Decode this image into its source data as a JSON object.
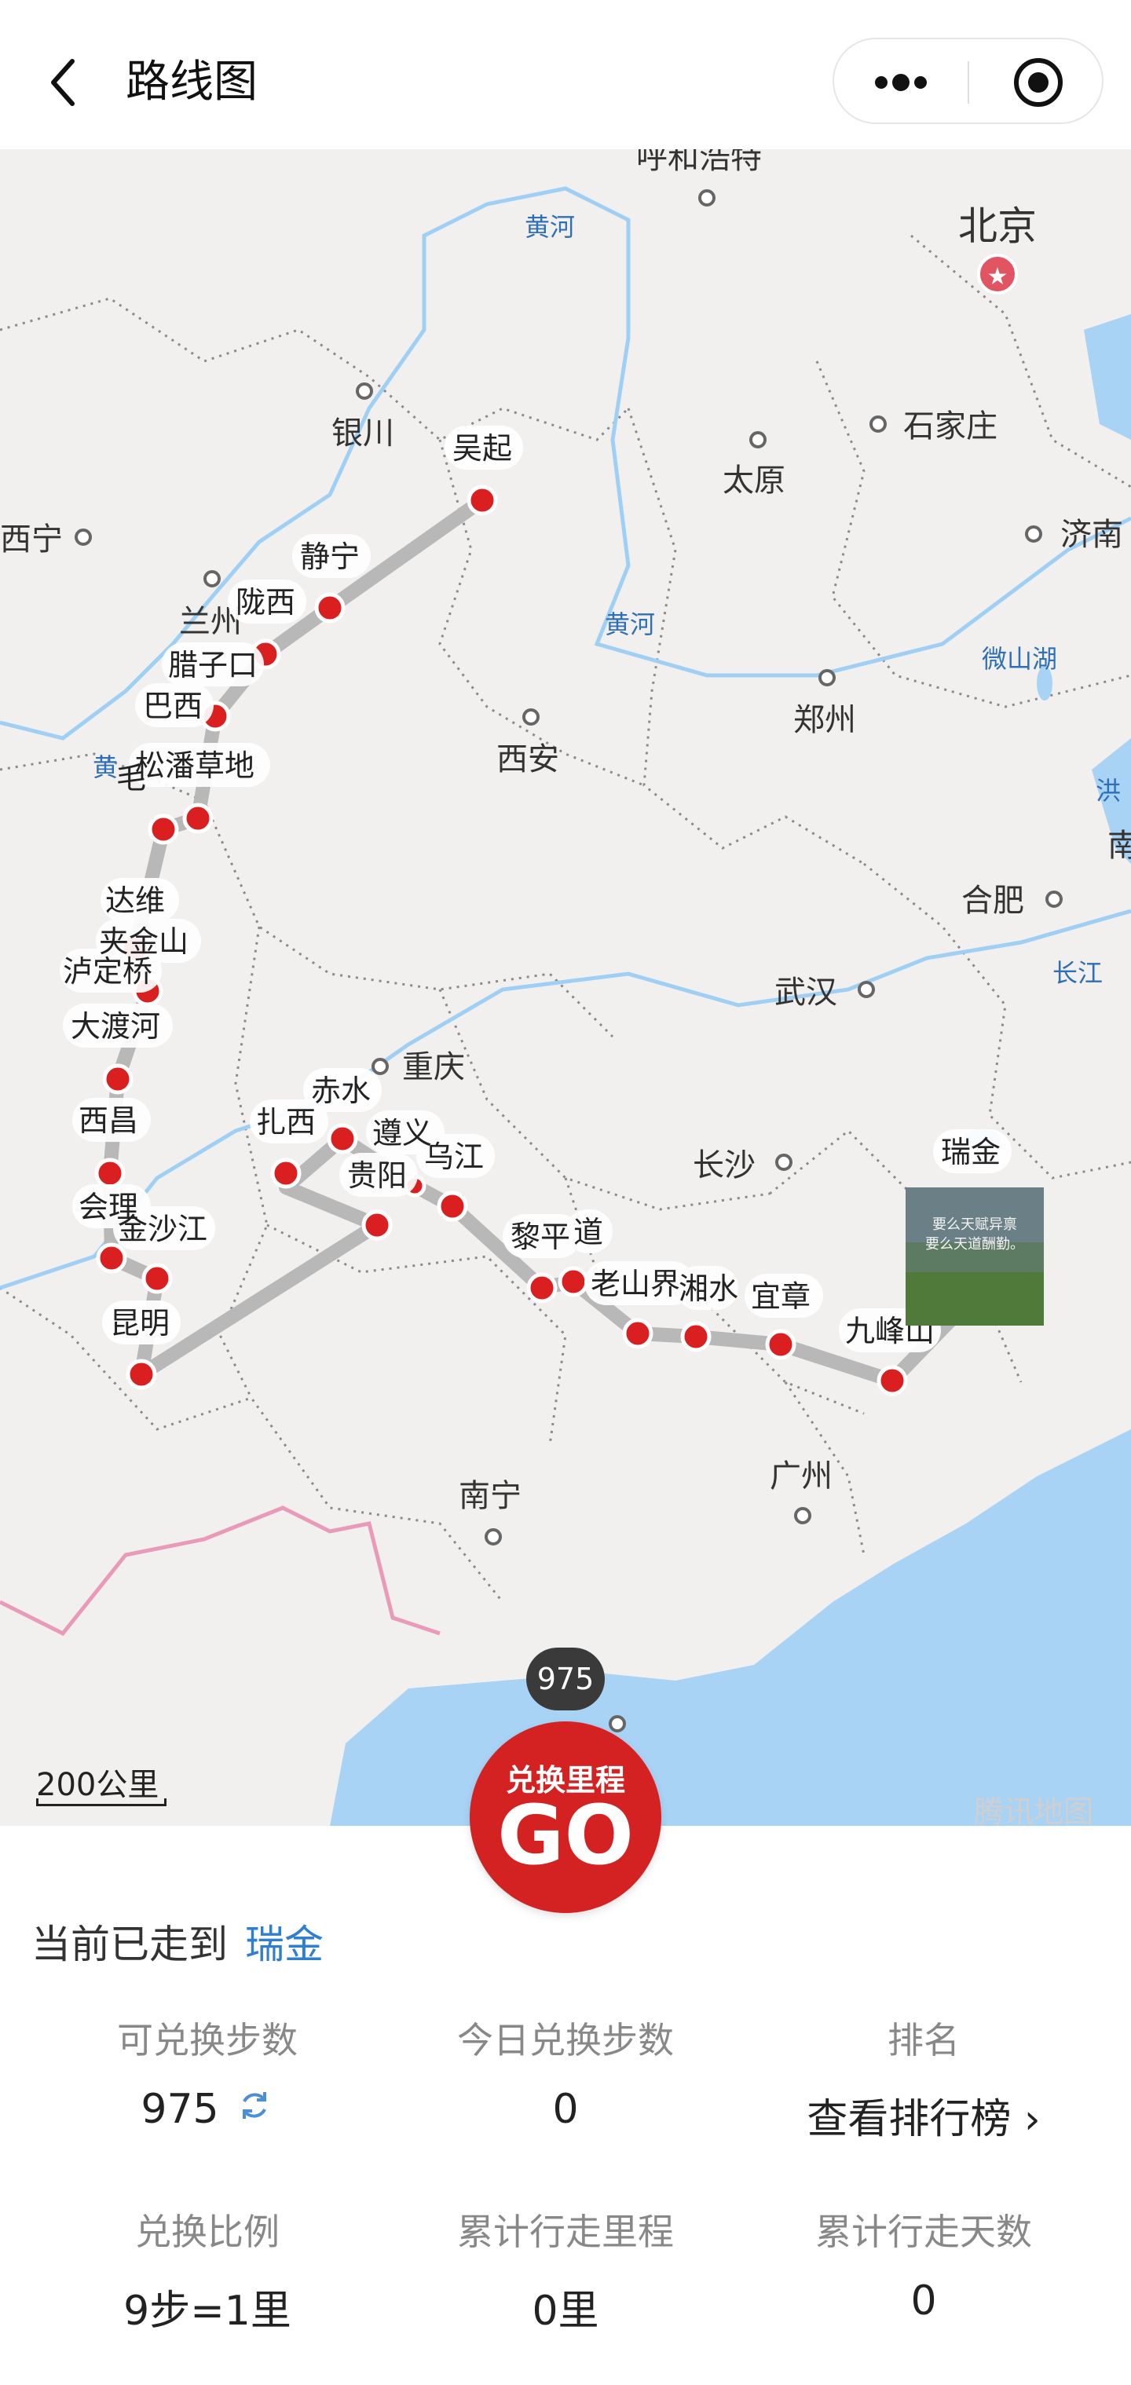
{
  "header": {
    "title": "路线图",
    "back_icon": "chevron-left-icon",
    "more_icon": "more-icon",
    "target_icon": "target-icon"
  },
  "map": {
    "cities": {
      "beijing": "北京",
      "huhehaote": "呼和浩特",
      "shijiazhuang": "石家庄",
      "taiyuan": "太原",
      "jinan": "济南",
      "yinchuan": "银川",
      "xining": "西宁",
      "lanzhou": "兰州",
      "xian": "西安",
      "zhengzhou": "郑州",
      "hefei": "合肥",
      "wuhan": "武汉",
      "chongqing": "重庆",
      "changsha": "长沙",
      "guangzhou": "广州",
      "nanning": "南宁",
      "nan": "南",
      "hong": "洪"
    },
    "water": {
      "huanghe1": "黄河",
      "huanghe2": "黄河",
      "huanghe3": "黄",
      "weishanhu": "微山湖",
      "changjiang": "长江"
    },
    "stops": {
      "wuqi": "吴起",
      "jingning": "静宁",
      "longxi": "陇西",
      "lazikou": "腊子口",
      "baxi": "巴西",
      "songpan": "松潘草地",
      "mao": "毛",
      "dawei": "达维",
      "jiajinshan": "夹金山",
      "luding": "泸定桥",
      "daduhe": "大渡河",
      "xichang": "西昌",
      "huili": "会理",
      "jinshajiang": "金沙江",
      "kunming": "昆明",
      "zhaxi": "扎西",
      "chishui": "赤水",
      "zunyi": "遵义",
      "guiyang": "贵阳",
      "wujiang": "乌江",
      "liping": "黎平",
      "tongdao": "道",
      "laoshanjie": "老山界",
      "xiangshui": "湘水",
      "yizhang": "宜章",
      "jiufengshan": "九峰山",
      "ruijin": "瑞金"
    },
    "mileage_bubble": "975",
    "scale_label": "200公里",
    "attribution": "腾讯地图",
    "photo_text": "要么天赋异禀\n要么天道酬勤。"
  },
  "go_button": {
    "small": "兑换里程",
    "big": "GO"
  },
  "progress": {
    "prefix": "当前已走到",
    "place": "瑞金"
  },
  "stats": {
    "convertible_steps_label": "可兑换步数",
    "convertible_steps_value": "975",
    "today_label": "今日兑换步数",
    "today_value": "0",
    "rank_label": "排名",
    "rank_link": "查看排行榜 ›",
    "ratio_label": "兑换比例",
    "ratio_value": "9步=1里",
    "total_distance_label": "累计行走里程",
    "total_distance_value": "0里",
    "total_days_label": "累计行走天数",
    "total_days_value": "0"
  },
  "colors": {
    "route": "#b8b8b8",
    "stop": "#d91f1f",
    "go": "#d42121",
    "link": "#2f7fd0",
    "sea": "#a9d3f5",
    "land": "#f1f0ee"
  }
}
